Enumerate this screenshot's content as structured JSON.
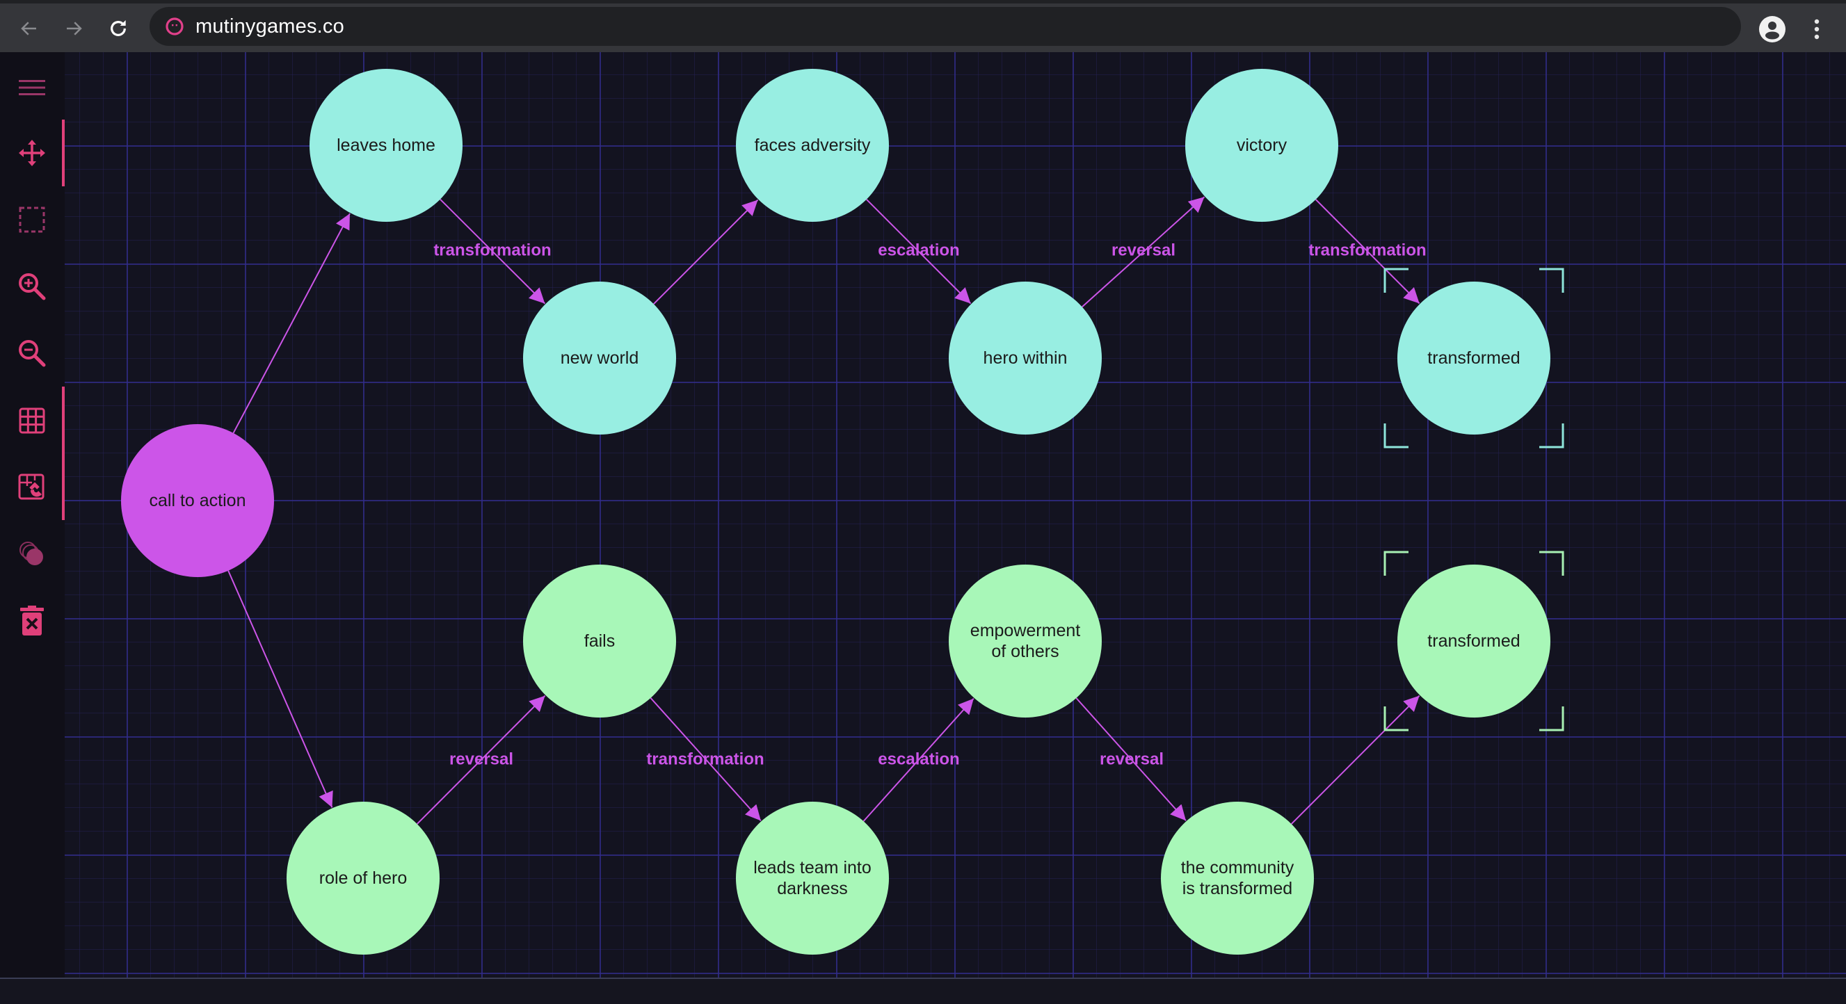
{
  "browser": {
    "url": "mutinygames.co",
    "back_icon": "arrow-left-icon",
    "forward_icon": "arrow-right-icon",
    "reload_icon": "reload-icon",
    "favicon": "mutiny-face-icon",
    "profile_icon": "account-circle-icon",
    "menu_icon": "kebab-menu-icon"
  },
  "colors": {
    "accent": "#e0407a",
    "edge": "#cc55e8",
    "root_node": "#cc55e8",
    "top_branch_node": "#98eee2",
    "bottom_branch_node": "#a8f7b8",
    "selection_top": "#8fe6dc",
    "selection_bottom": "#a8f0b4"
  },
  "sidebar": {
    "tools": [
      {
        "id": "menu",
        "icon": "hamburger-menu-icon",
        "label": "Menu",
        "active": false
      },
      {
        "id": "move",
        "icon": "move-arrows-icon",
        "label": "Move",
        "active": true
      },
      {
        "id": "select",
        "icon": "marquee-select-icon",
        "label": "Select",
        "active": false
      },
      {
        "id": "zoom-in",
        "icon": "zoom-in-icon",
        "label": "Zoom in",
        "active": false
      },
      {
        "id": "zoom-out",
        "icon": "zoom-out-icon",
        "label": "Zoom out",
        "active": false
      },
      {
        "id": "grid",
        "icon": "grid-icon",
        "label": "Grid",
        "active": true
      },
      {
        "id": "snap",
        "icon": "snap-to-grid-magnet-icon",
        "label": "Snap to grid",
        "active": true
      },
      {
        "id": "layers",
        "icon": "stacked-circles-icon",
        "label": "Stack",
        "active": false
      },
      {
        "id": "delete",
        "icon": "trash-delete-icon",
        "label": "Delete",
        "active": false
      }
    ]
  },
  "graph": {
    "nodes": [
      {
        "id": "n0",
        "lines": [
          "call to action"
        ],
        "group": "root",
        "selected": false
      },
      {
        "id": "n1",
        "lines": [
          "leaves home"
        ],
        "group": "top",
        "selected": false
      },
      {
        "id": "n2",
        "lines": [
          "new world"
        ],
        "group": "top",
        "selected": false
      },
      {
        "id": "n3",
        "lines": [
          "faces adversity"
        ],
        "group": "top",
        "selected": false
      },
      {
        "id": "n4",
        "lines": [
          "hero within"
        ],
        "group": "top",
        "selected": false
      },
      {
        "id": "n5",
        "lines": [
          "victory"
        ],
        "group": "top",
        "selected": false
      },
      {
        "id": "n6",
        "lines": [
          "transformed"
        ],
        "group": "top",
        "selected": true
      },
      {
        "id": "n7",
        "lines": [
          "role of hero"
        ],
        "group": "bottom",
        "selected": false
      },
      {
        "id": "n8",
        "lines": [
          "fails"
        ],
        "group": "bottom",
        "selected": false
      },
      {
        "id": "n9",
        "lines": [
          "leads team into",
          "darkness"
        ],
        "group": "bottom",
        "selected": false
      },
      {
        "id": "n10",
        "lines": [
          "empowerment",
          "of others"
        ],
        "group": "bottom",
        "selected": false
      },
      {
        "id": "n11",
        "lines": [
          "the community",
          "is transformed"
        ],
        "group": "bottom",
        "selected": false
      },
      {
        "id": "n12",
        "lines": [
          "transformed"
        ],
        "group": "bottom",
        "selected": true
      }
    ],
    "edges": [
      {
        "from": "n0",
        "to": "n1",
        "label": ""
      },
      {
        "from": "n1",
        "to": "n2",
        "label": "transformation"
      },
      {
        "from": "n2",
        "to": "n3",
        "label": ""
      },
      {
        "from": "n3",
        "to": "n4",
        "label": "escalation"
      },
      {
        "from": "n4",
        "to": "n5",
        "label": "reversal"
      },
      {
        "from": "n5",
        "to": "n6",
        "label": "transformation"
      },
      {
        "from": "n0",
        "to": "n7",
        "label": ""
      },
      {
        "from": "n7",
        "to": "n8",
        "label": "reversal"
      },
      {
        "from": "n8",
        "to": "n9",
        "label": "transformation"
      },
      {
        "from": "n9",
        "to": "n10",
        "label": "escalation"
      },
      {
        "from": "n10",
        "to": "n11",
        "label": "reversal"
      },
      {
        "from": "n11",
        "to": "n12",
        "label": ""
      }
    ]
  }
}
